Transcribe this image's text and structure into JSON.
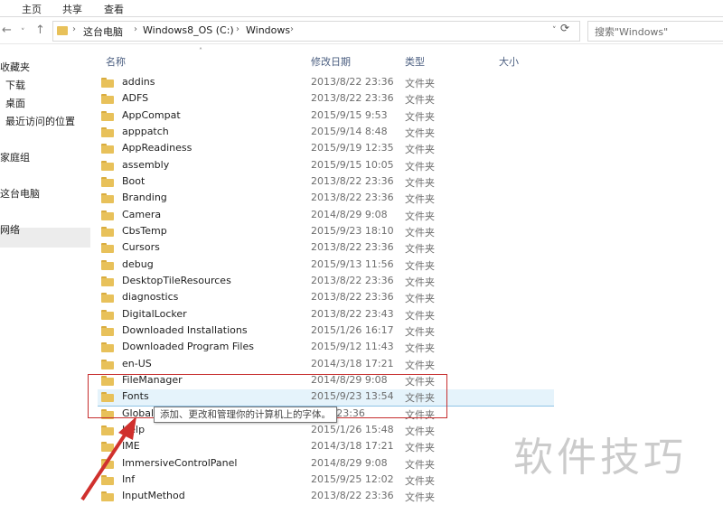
{
  "ribbon": {
    "tabs": [
      "主页",
      "共享",
      "查看"
    ]
  },
  "address": {
    "crumbs": [
      "这台电脑",
      "Windows8_OS (C:)",
      "Windows"
    ]
  },
  "search": {
    "placeholder": "搜索\"Windows\""
  },
  "sidebar": {
    "items": [
      "收藏夹",
      "下载",
      "桌面",
      "最近访问的位置",
      "家庭组",
      "这台电脑",
      "网络"
    ]
  },
  "columns": {
    "name": "名称",
    "date": "修改日期",
    "type": "类型",
    "size": "大小"
  },
  "files": [
    {
      "name": "addins",
      "date": "2013/8/22 23:36",
      "type": "文件夹"
    },
    {
      "name": "ADFS",
      "date": "2013/8/22 23:36",
      "type": "文件夹"
    },
    {
      "name": "AppCompat",
      "date": "2015/9/15 9:53",
      "type": "文件夹"
    },
    {
      "name": "apppatch",
      "date": "2015/9/14 8:48",
      "type": "文件夹"
    },
    {
      "name": "AppReadiness",
      "date": "2015/9/19 12:35",
      "type": "文件夹"
    },
    {
      "name": "assembly",
      "date": "2015/9/15 10:05",
      "type": "文件夹"
    },
    {
      "name": "Boot",
      "date": "2013/8/22 23:36",
      "type": "文件夹"
    },
    {
      "name": "Branding",
      "date": "2013/8/22 23:36",
      "type": "文件夹"
    },
    {
      "name": "Camera",
      "date": "2014/8/29 9:08",
      "type": "文件夹"
    },
    {
      "name": "CbsTemp",
      "date": "2015/9/23 18:10",
      "type": "文件夹"
    },
    {
      "name": "Cursors",
      "date": "2013/8/22 23:36",
      "type": "文件夹"
    },
    {
      "name": "debug",
      "date": "2015/9/13 11:56",
      "type": "文件夹"
    },
    {
      "name": "DesktopTileResources",
      "date": "2013/8/22 23:36",
      "type": "文件夹"
    },
    {
      "name": "diagnostics",
      "date": "2013/8/22 23:36",
      "type": "文件夹"
    },
    {
      "name": "DigitalLocker",
      "date": "2013/8/22 23:43",
      "type": "文件夹"
    },
    {
      "name": "Downloaded Installations",
      "date": "2015/1/26 16:17",
      "type": "文件夹"
    },
    {
      "name": "Downloaded Program Files",
      "date": "2015/9/12 11:43",
      "type": "文件夹"
    },
    {
      "name": "en-US",
      "date": "2014/3/18 17:21",
      "type": "文件夹"
    },
    {
      "name": "FileManager",
      "date": "2014/8/29 9:08",
      "type": "文件夹"
    },
    {
      "name": "Fonts",
      "date": "2015/9/23 13:54",
      "type": "文件夹"
    },
    {
      "name": "Globali",
      "date": "8/22 23:36",
      "type": "文件夹"
    },
    {
      "name": "Help",
      "date": "2015/1/26 15:48",
      "type": "文件夹"
    },
    {
      "name": "IME",
      "date": "2014/3/18 17:21",
      "type": "文件夹"
    },
    {
      "name": "ImmersiveControlPanel",
      "date": "2014/8/29 9:08",
      "type": "文件夹"
    },
    {
      "name": "Inf",
      "date": "2015/9/25 12:02",
      "type": "文件夹"
    },
    {
      "name": "InputMethod",
      "date": "2013/8/22 23:36",
      "type": "文件夹"
    }
  ],
  "tooltip": {
    "text": "添加、更改和管理你的计算机上的字体。"
  },
  "watermark": "软件技巧",
  "colors": {
    "highlight": "#e5f3fb",
    "redbox": "#c62e2e",
    "folder": "#e8c15a"
  }
}
